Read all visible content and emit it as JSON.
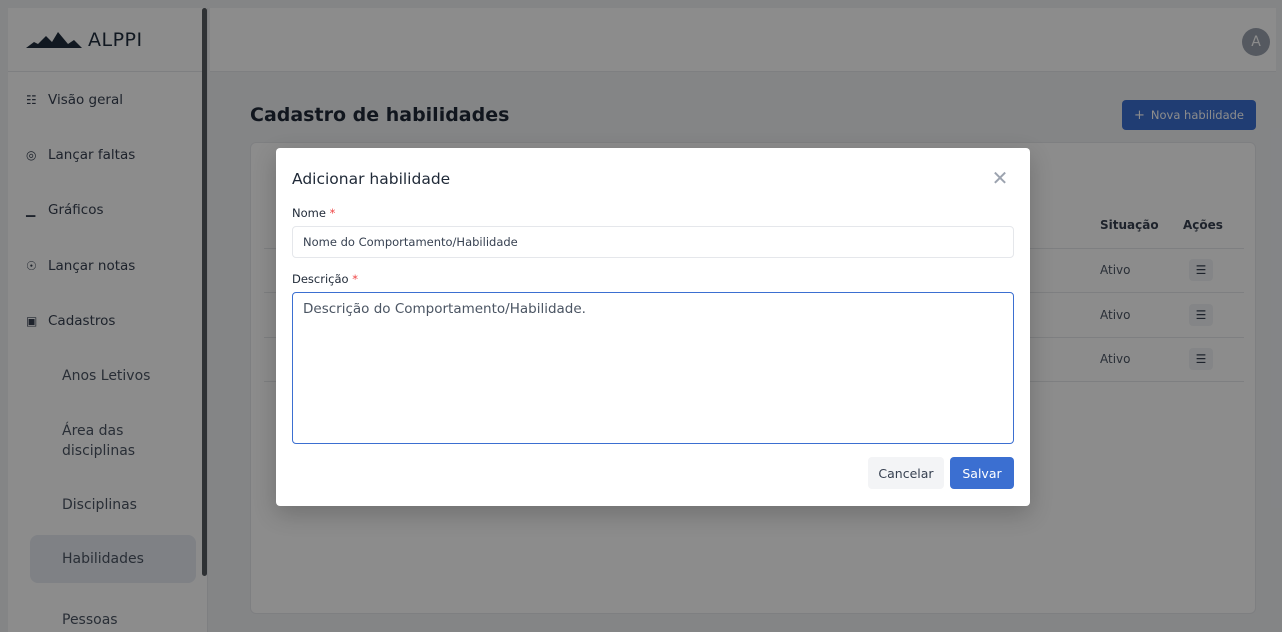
{
  "app": {
    "name": "ALPPI",
    "user_initial": "A"
  },
  "sidebar": {
    "items": [
      {
        "label": "Visão geral",
        "icon": "grid-icon"
      },
      {
        "label": "Lançar faltas",
        "icon": "eye-icon"
      },
      {
        "label": "Gráficos",
        "icon": "chart-icon"
      },
      {
        "label": "Lançar notas",
        "icon": "signal-icon"
      },
      {
        "label": "Cadastros",
        "icon": "form-icon"
      }
    ],
    "subitems": [
      {
        "label": "Anos Letivos"
      },
      {
        "label": "Área das disciplinas"
      },
      {
        "label": "Disciplinas"
      },
      {
        "label": "Habilidades",
        "active": true
      },
      {
        "label": "Pessoas"
      }
    ]
  },
  "page": {
    "title": "Cadastro de habilidades",
    "new_button": "Nova habilidade",
    "table": {
      "columns": [
        "Situação",
        "Ações"
      ],
      "rows": [
        {
          "status": "Ativo"
        },
        {
          "status": "Ativo"
        },
        {
          "status": "Ativo"
        }
      ]
    }
  },
  "modal": {
    "title": "Adicionar habilidade",
    "name_label": "Nome",
    "name_placeholder": "Nome do Comportamento/Habilidade",
    "desc_label": "Descrição",
    "desc_value": "Descrição do Comportamento/Habilidade.",
    "cancel_label": "Cancelar",
    "save_label": "Salvar"
  },
  "colors": {
    "primary": "#3b6fd1",
    "required": "#ef4444",
    "overlay": "rgba(0,0,0,0.45)"
  }
}
